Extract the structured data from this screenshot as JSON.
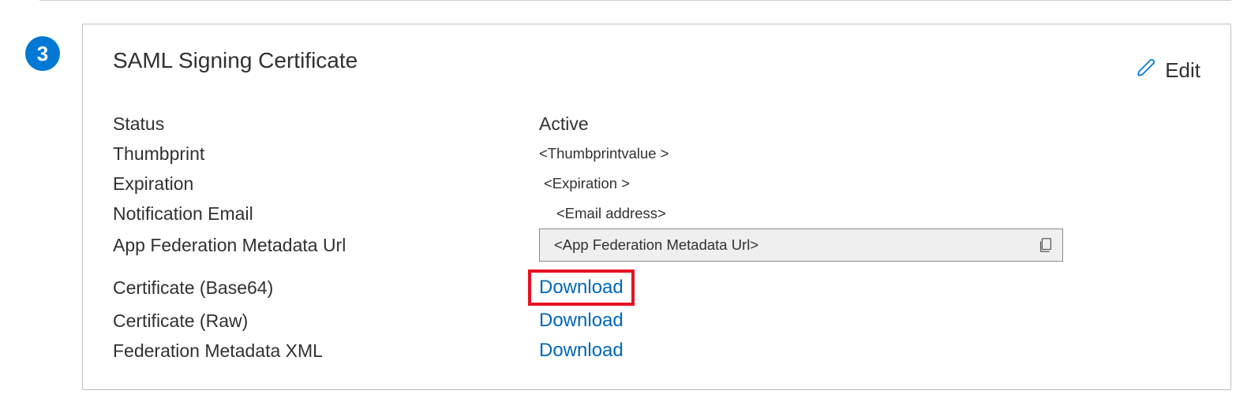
{
  "step_number": "3",
  "card": {
    "title": "SAML Signing Certificate",
    "edit_label": "Edit"
  },
  "fields": {
    "status": {
      "label": "Status",
      "value": "Active"
    },
    "thumbprint": {
      "label": "Thumbprint",
      "value": "<Thumbprintvalue >"
    },
    "expiration": {
      "label": "Expiration",
      "value": "<Expiration >"
    },
    "notification_email": {
      "label": "Notification Email",
      "value": "<Email address>"
    },
    "federation_url": {
      "label": "App Federation Metadata Url",
      "value": "<App Federation Metadata Url>"
    },
    "cert_base64": {
      "label": "Certificate (Base64)",
      "action": "Download"
    },
    "cert_raw": {
      "label": "Certificate (Raw)",
      "action": "Download"
    },
    "metadata_xml": {
      "label": "Federation Metadata XML",
      "action": "Download"
    }
  }
}
